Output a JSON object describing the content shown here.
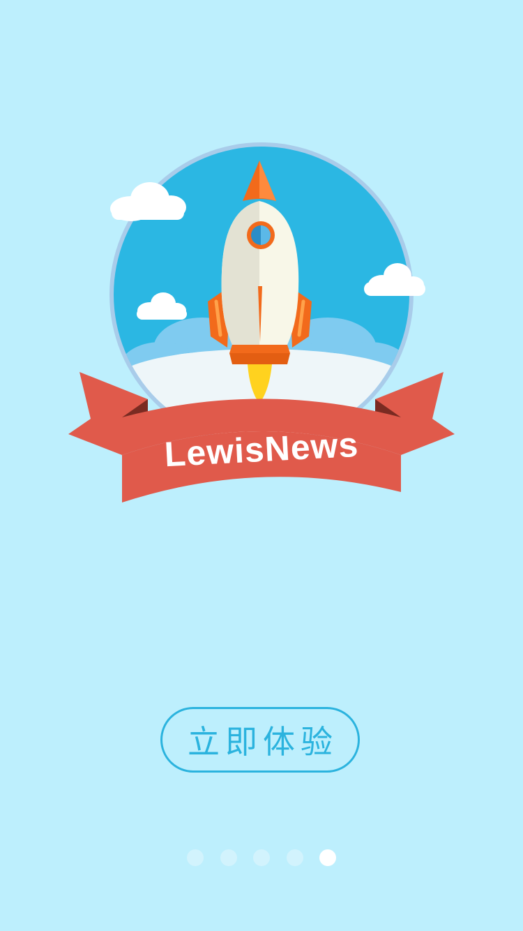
{
  "logo": {
    "brand_text": "LewisNews"
  },
  "cta": {
    "label": "立即体验"
  },
  "pager": {
    "pages": 5,
    "active_index": 4
  },
  "colors": {
    "background": "#BDEFFD",
    "sky": "#2BB7E3",
    "ribbon": "#E05A4B",
    "accent": "#2BB3DE",
    "rocket_orange": "#F26A1B"
  }
}
